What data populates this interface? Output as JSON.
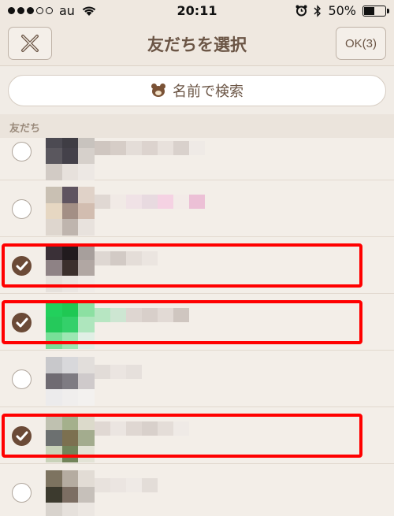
{
  "status": {
    "carrier": "au",
    "time": "20:11",
    "battery_text": "50%",
    "battery_level": 0.5
  },
  "nav": {
    "title": "友だちを選択",
    "close_icon": "close-x-icon",
    "ok_label": "OK(3)"
  },
  "search": {
    "placeholder": "名前で検索",
    "icon": "bear-icon"
  },
  "section_header": "友だち",
  "colors": {
    "accent_brown": "#6b4a37",
    "highlight_red": "#ff0000",
    "background": "#f1ece6"
  },
  "friends": [
    {
      "checked": false,
      "avatar": [
        "#4c4a52",
        "#3f3d44",
        "#c8c3be",
        "#5a575e",
        "#44414a",
        "#d6d0cb",
        "#d2cbc5",
        "#e7e1dc",
        "#ede8e4"
      ],
      "name_colors": [
        "#cfc6c0",
        "#d6cdc7",
        "#e4ddd8",
        "#dcd3ce",
        "#e8e1dc",
        "#d9d1cc",
        "#efeae6"
      ]
    },
    {
      "checked": false,
      "avatar": [
        "#c9c0b3",
        "#5f5460",
        "#e0d2c8",
        "#e6d7c2",
        "#a38f85",
        "#d2bdb0",
        "#ded6ce",
        "#bfb5ae",
        "#e8e2dd"
      ],
      "name_colors": [
        "#e0d8d3",
        "#f1eae6",
        "#f0e2e6",
        "#e8dae0",
        "#f5d2e3",
        "#f3ebe8",
        "#ecc0d6"
      ]
    },
    {
      "checked": true,
      "avatar": [
        "#3a3037",
        "#211b1e",
        "#a79f9c",
        "#8e8285",
        "#3b2f2c",
        "#b1a7a3",
        "#e6e1dc",
        "#ebe6e2",
        "#f0ebe7"
      ],
      "name_colors": [
        "#ded7d2",
        "#d2cac5",
        "#e4ddd8",
        "#ebe5e0"
      ]
    },
    {
      "checked": true,
      "avatar": [
        "#22d05c",
        "#1fc853",
        "#8ce0a2",
        "#25c95b",
        "#34d06a",
        "#aee6bd",
        "#79df98",
        "#9ce7b2",
        "#e1efe5"
      ],
      "name_colors": [
        "#b7e6c2",
        "#cde6d2",
        "#ded6d1",
        "#d8cfca",
        "#e2dad5",
        "#cfc6c0"
      ]
    },
    {
      "checked": false,
      "avatar": [
        "#c8c8cb",
        "#d8d8db",
        "#e2dedb",
        "#6f6b72",
        "#7e7b82",
        "#cfcacb",
        "#ecebec",
        "#f0eeed",
        "#f3f1ef"
      ],
      "name_colors": [
        "#e2dcd8",
        "#ebe5e1",
        "#e6e0dc"
      ]
    },
    {
      "checked": true,
      "avatar": [
        "#bfc1b0",
        "#a4b08c",
        "#dcdacb",
        "#6c7070",
        "#7c7050",
        "#a3ac8e",
        "#c9d2b9",
        "#72845a",
        "#e3e3d6"
      ],
      "name_colors": [
        "#e0d8d3",
        "#ebe5e1",
        "#dfd7d2",
        "#d8d0cb",
        "#e4ddd8",
        "#efeae6"
      ]
    },
    {
      "checked": false,
      "avatar": [
        "#7d7360",
        "#b5aca1",
        "#e2dcd5",
        "#3c3a2e",
        "#7c6e63",
        "#c6c0ba",
        "#d8d3cd",
        "#e6e1dc",
        "#ece7e2"
      ],
      "name_colors": [
        "#e8e2dd",
        "#ebe5e1",
        "#efeae6",
        "#e3ddd8"
      ]
    }
  ]
}
